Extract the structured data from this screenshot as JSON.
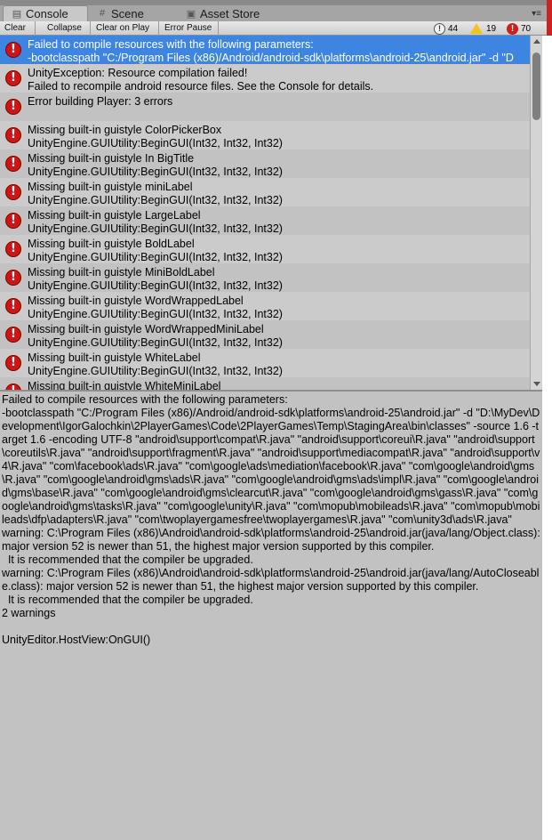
{
  "tabs": [
    {
      "label": "Console",
      "icon": "console-icon"
    },
    {
      "label": "Scene",
      "icon": "scene-grid-icon"
    },
    {
      "label": "Asset Store",
      "icon": "asset-store-bag-icon"
    }
  ],
  "toolbar": {
    "clear": "Clear",
    "collapse": "Collapse",
    "clear_on_play": "Clear on Play",
    "error_pause": "Error Pause",
    "info_count": "44",
    "warning_count": "19",
    "error_count": "70",
    "info_glyph": "!",
    "error_glyph": "!"
  },
  "colors": {
    "selected_row": "#3d85e0",
    "error_icon": "#cc1616",
    "warning_icon": "#f0c419"
  },
  "log_entries": [
    {
      "line1": "Failed to compile resources with the following parameters:",
      "line2": "-bootclasspath \"C:/Program Files (x86)/Android/android-sdk\\platforms\\android-25\\android.jar\" -d \"D"
    },
    {
      "line1": "UnityException: Resource compilation failed!",
      "line2": "Failed to recompile android resource files. See the Console for details."
    },
    {
      "line1": "Error building Player: 3 errors",
      "line2": ""
    },
    {
      "line1": "Missing built-in guistyle ColorPickerBox",
      "line2": "UnityEngine.GUIUtility:BeginGUI(Int32, Int32, Int32)"
    },
    {
      "line1": "Missing built-in guistyle In BigTitle",
      "line2": "UnityEngine.GUIUtility:BeginGUI(Int32, Int32, Int32)"
    },
    {
      "line1": "Missing built-in guistyle miniLabel",
      "line2": "UnityEngine.GUIUtility:BeginGUI(Int32, Int32, Int32)"
    },
    {
      "line1": "Missing built-in guistyle LargeLabel",
      "line2": "UnityEngine.GUIUtility:BeginGUI(Int32, Int32, Int32)"
    },
    {
      "line1": "Missing built-in guistyle BoldLabel",
      "line2": "UnityEngine.GUIUtility:BeginGUI(Int32, Int32, Int32)"
    },
    {
      "line1": "Missing built-in guistyle MiniBoldLabel",
      "line2": "UnityEngine.GUIUtility:BeginGUI(Int32, Int32, Int32)"
    },
    {
      "line1": "Missing built-in guistyle WordWrappedLabel",
      "line2": "UnityEngine.GUIUtility:BeginGUI(Int32, Int32, Int32)"
    },
    {
      "line1": "Missing built-in guistyle WordWrappedMiniLabel",
      "line2": "UnityEngine.GUIUtility:BeginGUI(Int32, Int32, Int32)"
    },
    {
      "line1": "Missing built-in guistyle WhiteLabel",
      "line2": "UnityEngine.GUIUtility:BeginGUI(Int32, Int32, Int32)"
    },
    {
      "line1": "Missing built-in guistyle WhiteMiniLabel",
      "line2": ""
    }
  ],
  "detail_text": "Failed to compile resources with the following parameters:\n-bootclasspath \"C:/Program Files (x86)/Android/android-sdk\\platforms\\android-25\\android.jar\" -d \"D:\\MyDev\\Development\\IgorGalochkin\\2PlayerGames\\Code\\2PlayerGames\\Temp\\StagingArea\\bin\\classes\" -source 1.6 -target 1.6 -encoding UTF-8 \"android\\support\\compat\\R.java\" \"android\\support\\coreui\\R.java\" \"android\\support\\coreutils\\R.java\" \"android\\support\\fragment\\R.java\" \"android\\support\\mediacompat\\R.java\" \"android\\support\\v4\\R.java\" \"com\\facebook\\ads\\R.java\" \"com\\google\\ads\\mediation\\facebook\\R.java\" \"com\\google\\android\\gms\\R.java\" \"com\\google\\android\\gms\\ads\\R.java\" \"com\\google\\android\\gms\\ads\\impl\\R.java\" \"com\\google\\android\\gms\\base\\R.java\" \"com\\google\\android\\gms\\clearcut\\R.java\" \"com\\google\\android\\gms\\gass\\R.java\" \"com\\google\\android\\gms\\tasks\\R.java\" \"com\\google\\unity\\R.java\" \"com\\mopub\\mobileads\\R.java\" \"com\\mopub\\mobileads\\dfp\\adapters\\R.java\" \"com\\twoplayergamesfree\\twoplayergames\\R.java\" \"com\\unity3d\\ads\\R.java\"\nwarning: C:\\Program Files (x86)\\Android\\android-sdk\\platforms\\android-25\\android.jar(java/lang/Object.class): major version 52 is newer than 51, the highest major version supported by this compiler.\n  It is recommended that the compiler be upgraded.\nwarning: C:\\Program Files (x86)\\Android\\android-sdk\\platforms\\android-25\\android.jar(java/lang/AutoCloseable.class): major version 52 is newer than 51, the highest major version supported by this compiler.\n  It is recommended that the compiler be upgraded.\n2 warnings\n\nUnityEditor.HostView:OnGUI()"
}
